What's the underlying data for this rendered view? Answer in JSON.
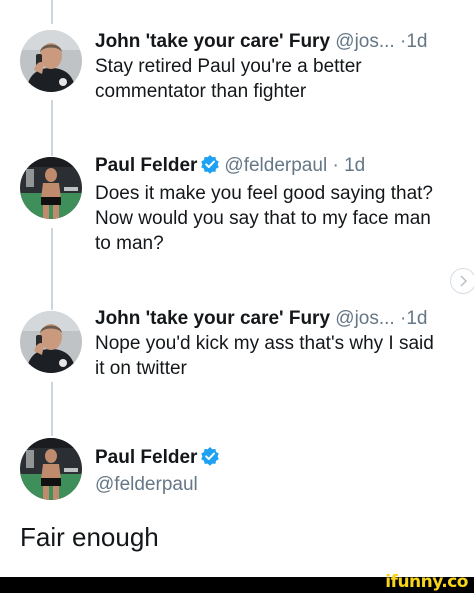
{
  "tweets": [
    {
      "name": "John 'take your care' Fury",
      "handle": "@jos...",
      "dot": "·",
      "time": "1d",
      "text_lines": [
        "Stay retired Paul you're a better",
        "commentator than fighter"
      ],
      "avatar_icon": "man-on-phone-avatar"
    },
    {
      "name": "Paul Felder",
      "handle": "@felderpaul",
      "dot": "·",
      "time": "1d",
      "verified": true,
      "text_lines": [
        "Does it make you feel good saying that?",
        "Now would you say that to my face man",
        "to man?"
      ],
      "avatar_icon": "fighter-in-cage-avatar"
    },
    {
      "name": "John 'take your care' Fury",
      "handle": "@jos...",
      "dot": "·",
      "time": "1d",
      "text_lines": [
        "Nope you'd kick my ass that's why I said",
        "it on twitter"
      ],
      "avatar_icon": "man-on-phone-avatar"
    },
    {
      "name": "Paul Felder",
      "handle": "@felderpaul",
      "verified": true,
      "avatar_icon": "fighter-in-cage-avatar"
    }
  ],
  "final_text": "Fair enough",
  "watermark": "ifunny.co",
  "colors": {
    "verified_blue": "#1da1f2",
    "handle_gray": "#657786",
    "thread_line": "#ccd6dd",
    "watermark_yellow": "#f7d51d"
  }
}
